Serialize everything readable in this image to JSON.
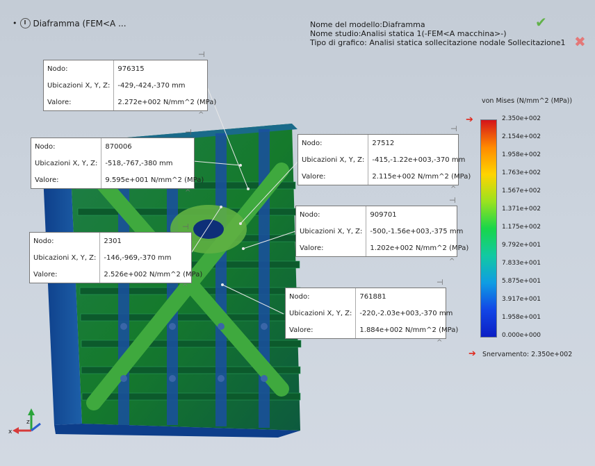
{
  "document": {
    "title": "Diaframma  (FEM<A ..."
  },
  "info": {
    "model_name": "Nome del modello:Diaframma",
    "study_name": "Nome studio:Analisi statica 1(-FEM<A macchina>-)",
    "plot_type": "Tipo di grafico: Analisi statica sollecitazione nodale Sollecitazione1"
  },
  "icons": {
    "ok": "checkmark-icon",
    "cancel": "close-icon",
    "pin": "pushpin-icon",
    "triad": "axis-triad-icon"
  },
  "colors": {
    "ok": "#62b24a",
    "cancel": "#e47878",
    "yield_marker": "#e0271b"
  },
  "probes": [
    {
      "node_label": "Nodo:",
      "node": "976315",
      "loc_label": "Ubicazioni X, Y, Z:",
      "loc": "-429,-424,-370 mm",
      "value_label": "Valore:",
      "value": "2.272e+002 N/mm^2 (MPa)"
    },
    {
      "node_label": "Nodo:",
      "node": "870006",
      "loc_label": "Ubicazioni X, Y, Z:",
      "loc": "-518,-767,-380 mm",
      "value_label": "Valore:",
      "value": "9.595e+001 N/mm^2 (MPa)"
    },
    {
      "node_label": "Nodo:",
      "node": "27512",
      "loc_label": "Ubicazioni X, Y, Z:",
      "loc": "-415,-1.22e+003,-370 mm",
      "value_label": "Valore:",
      "value": "2.115e+002 N/mm^2 (MPa)"
    },
    {
      "node_label": "Nodo:",
      "node": "909701",
      "loc_label": "Ubicazioni X, Y, Z:",
      "loc": "-500,-1.56e+003,-375 mm",
      "value_label": "Valore:",
      "value": "1.202e+002 N/mm^2 (MPa)"
    },
    {
      "node_label": "Nodo:",
      "node": "2301",
      "loc_label": "Ubicazioni X, Y, Z:",
      "loc": "-146,-969,-370 mm",
      "value_label": "Valore:",
      "value": "2.526e+002 N/mm^2 (MPa)"
    },
    {
      "node_label": "Nodo:",
      "node": "761881",
      "loc_label": "Ubicazioni X, Y, Z:",
      "loc": "-220,-2.03e+003,-370 mm",
      "value_label": "Valore:",
      "value": "1.884e+002 N/mm^2 (MPa)"
    }
  ],
  "legend": {
    "title": "von Mises (N/mm^2 (MPa))",
    "ticks": [
      "2.350e+002",
      "2.154e+002",
      "1.958e+002",
      "1.763e+002",
      "1.567e+002",
      "1.371e+002",
      "1.175e+002",
      "9.792e+001",
      "7.833e+001",
      "5.875e+001",
      "3.917e+001",
      "1.958e+001",
      "0.000e+000"
    ],
    "yield_label": "Snervamento: 2.350e+002",
    "colors": [
      "#d4141a",
      "#ff8a00",
      "#ffd400",
      "#9be21f",
      "#18d64a",
      "#12c9a2",
      "#0f9de3",
      "#1246e6",
      "#0b1fc4"
    ]
  },
  "triad": {
    "x": "x",
    "z": "z"
  }
}
